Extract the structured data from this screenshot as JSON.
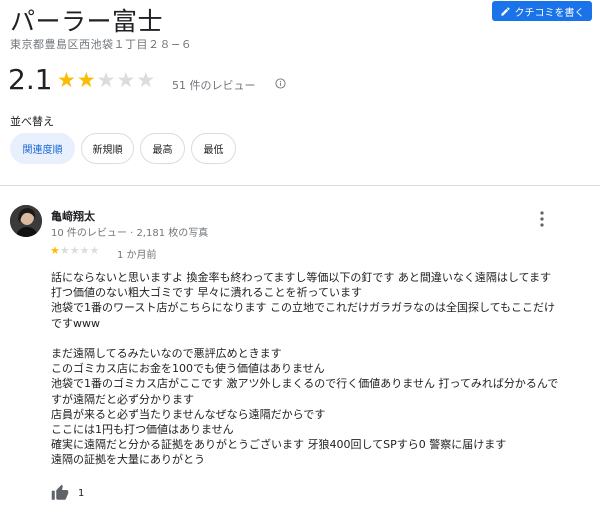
{
  "place": {
    "name": "パーラー富士",
    "address": "東京都豊島区西池袋１丁目２８−６",
    "rating": "2.1",
    "rating_value": 2.1,
    "review_count_text": "51 件のレビュー"
  },
  "write_review_label": "クチコミを書く",
  "sort": {
    "label": "並べ替え",
    "options": [
      "関連度順",
      "新規順",
      "最高",
      "最低"
    ],
    "selected": "関連度順"
  },
  "review": {
    "author": "亀﨑翔太",
    "author_meta": "10 件のレビュー · 2,181 枚の写真",
    "rating_value": 1,
    "time": "1 か月前",
    "lines": [
      "話にならないと思いますよ 換金率も終わってますし等価以下の釘です あと間違いなく遠隔はしてます",
      "打つ価値のない粗大ゴミです 早々に潰れることを祈っています",
      "池袋で1番のワースト店がこちらになります この立地でこれだけガラガラなのは全国探してもここだけ",
      "ですwww",
      "",
      "まだ遠隔してるみたいなので悪評広めときます",
      "このゴミカス店にお金を100でも使う価値はありません",
      "池袋で1番のゴミカス店がここです 激アツ外しまくるので行く価値ありません 打ってみれば分かるんで",
      "すが遠隔だと必ず分かります",
      "店員が来ると必ず当たりませんなぜなら遠隔だからです",
      "ここには1円も打つ価値はありません",
      "確実に遠隔だと分かる証拠をありがとうございます 牙狼400回してSPすら0 警察に届けます",
      "遠隔の証拠を大量にありがとう"
    ],
    "likes": "1"
  },
  "colors": {
    "accent": "#1a73e8",
    "star_filled": "#fbbc04",
    "star_empty": "#dadce0",
    "chip_active_bg": "#e8f0fe",
    "chip_active_text": "#1967d2"
  },
  "icons": {
    "write": "pencil-icon",
    "info": "info-icon",
    "more": "more-vert-icon",
    "like": "thumb-up-icon"
  }
}
